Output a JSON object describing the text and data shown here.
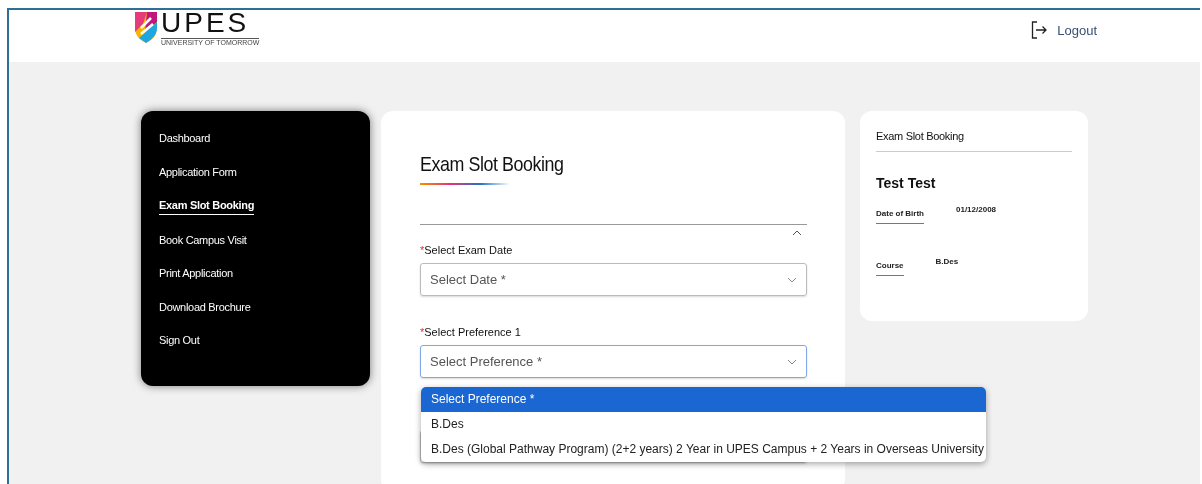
{
  "header": {
    "logo": {
      "wordmark": "UPES",
      "tagline": "UNIVERSITY OF TOMORROW"
    },
    "logout": "Logout"
  },
  "sidebar": {
    "items": [
      {
        "label": "Dashboard",
        "selected": false
      },
      {
        "label": "Application Form",
        "selected": false
      },
      {
        "label": "Exam Slot Booking",
        "selected": true
      },
      {
        "label": "Book Campus Visit",
        "selected": false
      },
      {
        "label": "Print Application",
        "selected": false
      },
      {
        "label": "Download Brochure",
        "selected": false
      },
      {
        "label": "Sign Out",
        "selected": false
      }
    ]
  },
  "form": {
    "title": "Exam Slot Booking",
    "fields": [
      {
        "label": "Select Exam Date",
        "required_mark": "*",
        "placeholder": "Select Date *",
        "focused": false
      },
      {
        "label": "Select Preference 1",
        "required_mark": "*",
        "placeholder": "Select Preference *",
        "focused": true
      }
    ],
    "dropdown": {
      "options": [
        {
          "label": "Select Preference *",
          "selected": true
        },
        {
          "label": "B.Des",
          "selected": false
        },
        {
          "label": "B.Des (Global Pathway Program) (2+2 years) 2 Year in UPES Campus + 2 Years in Overseas University",
          "selected": false
        }
      ]
    }
  },
  "summary": {
    "title": "Exam Slot Booking",
    "name": "Test Test",
    "details": [
      {
        "label": "Date of Birth",
        "value": "01/12/2008"
      },
      {
        "label": "Course",
        "value": "B.Des"
      }
    ]
  }
}
